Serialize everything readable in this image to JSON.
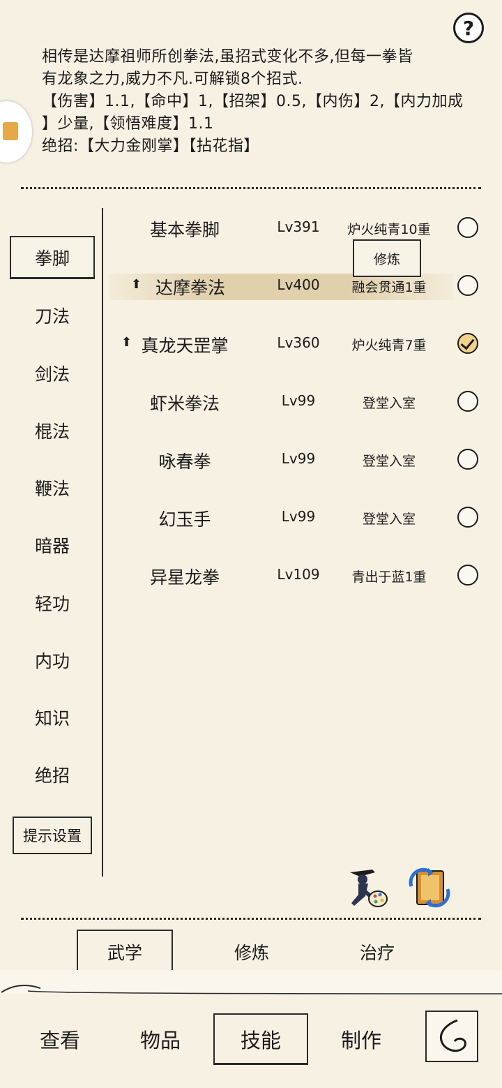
{
  "description": {
    "line1": "相传是达摩祖师所创拳法,虽招式变化不多,但每一拳皆",
    "line2": "有龙象之力,威力不凡.可解锁8个招式.",
    "line3": "【伤害】1.1,【命中】1,【招架】0.5,【内伤】2,【内力加成",
    "line4": "】少量,【领悟难度】1.1",
    "line5": "绝招:【大力金刚掌】【拈花指】"
  },
  "help_label": "?",
  "categories": [
    "拳脚",
    "刀法",
    "剑法",
    "棍法",
    "鞭法",
    "暗器",
    "轻功",
    "内功",
    "知识",
    "绝招"
  ],
  "hint_settings_label": "提示设置",
  "skills": [
    {
      "name": "基本拳脚",
      "level": "Lv391",
      "rank": "炉火纯青10重",
      "upgrade": false,
      "checked": false
    },
    {
      "name": "达摩拳法",
      "level": "Lv400",
      "rank": "融会贯通1重",
      "upgrade": true,
      "checked": false
    },
    {
      "name": "真龙天罡掌",
      "level": "Lv360",
      "rank": "炉火纯青7重",
      "upgrade": true,
      "checked": true
    },
    {
      "name": "虾米拳法",
      "level": "Lv99",
      "rank": "登堂入室",
      "upgrade": false,
      "checked": false
    },
    {
      "name": "咏春拳",
      "level": "Lv99",
      "rank": "登堂入室",
      "upgrade": false,
      "checked": false
    },
    {
      "name": "幻玉手",
      "level": "Lv99",
      "rank": "登堂入室",
      "upgrade": false,
      "checked": false
    },
    {
      "name": "异星龙拳",
      "level": "Lv109",
      "rank": "青出于蓝1重",
      "upgrade": false,
      "checked": false
    }
  ],
  "train_popup_label": "修炼",
  "sub_tabs": [
    "武学",
    "修炼",
    "治疗"
  ],
  "bottom_tabs": [
    "查看",
    "物品",
    "技能",
    "制作"
  ]
}
